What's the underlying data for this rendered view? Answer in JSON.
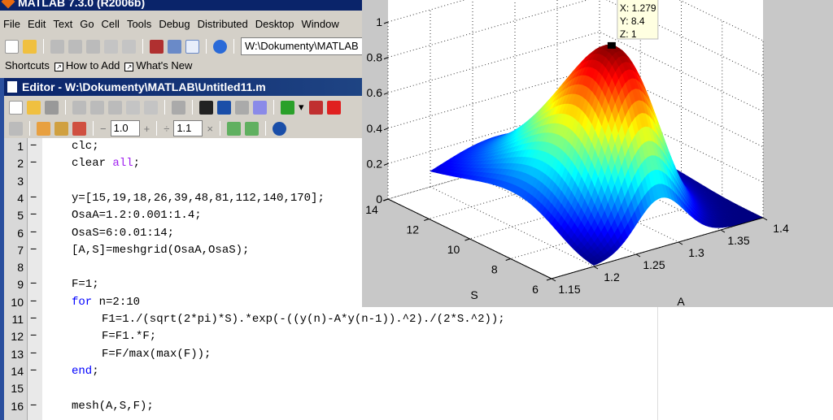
{
  "main_window": {
    "title": "MATLAB  7.3.0 (R2006b)",
    "menu": [
      "File",
      "Edit",
      "Text",
      "Go",
      "Cell",
      "Tools",
      "Debug",
      "Distributed",
      "Desktop",
      "Window"
    ],
    "current_directory": "W:\\Dokumenty\\MATLAB",
    "shortcuts_label": "Shortcuts",
    "shortcuts": [
      "How to Add",
      "What's New"
    ]
  },
  "editor": {
    "title": "Editor - W:\\Dokumenty\\MATLAB\\Untitled11.m",
    "cell_decrement_value": "1.0",
    "cell_divide_value": "1.1",
    "lines": [
      {
        "n": "1",
        "dash": true,
        "indent": 0,
        "parts": [
          {
            "t": "clc;"
          }
        ]
      },
      {
        "n": "2",
        "dash": true,
        "indent": 0,
        "parts": [
          {
            "t": "clear "
          },
          {
            "t": "all",
            "c": "str"
          },
          {
            "t": ";"
          }
        ]
      },
      {
        "n": "3",
        "dash": false,
        "indent": 0,
        "parts": []
      },
      {
        "n": "4",
        "dash": true,
        "indent": 0,
        "parts": [
          {
            "t": "y=[15,19,18,26,39,48,81,112,140,170];"
          }
        ]
      },
      {
        "n": "5",
        "dash": true,
        "indent": 0,
        "parts": [
          {
            "t": "OsaA=1.2:0.001:1.4;"
          }
        ]
      },
      {
        "n": "6",
        "dash": true,
        "indent": 0,
        "parts": [
          {
            "t": "OsaS=6:0.01:14;"
          }
        ]
      },
      {
        "n": "7",
        "dash": true,
        "indent": 0,
        "parts": [
          {
            "t": "[A,S]=meshgrid(OsaA,OsaS);"
          }
        ]
      },
      {
        "n": "8",
        "dash": false,
        "indent": 0,
        "parts": []
      },
      {
        "n": "9",
        "dash": true,
        "indent": 0,
        "parts": [
          {
            "t": "F=1;"
          }
        ]
      },
      {
        "n": "10",
        "dash": true,
        "indent": 0,
        "parts": [
          {
            "t": "for",
            "c": "kw"
          },
          {
            "t": " n=2:10"
          }
        ]
      },
      {
        "n": "11",
        "dash": true,
        "indent": 1,
        "parts": [
          {
            "t": "F1=1./(sqrt(2*pi)*S).*exp(-((y(n)-A*y(n-1)).^2)./(2*S.^2));"
          }
        ]
      },
      {
        "n": "12",
        "dash": true,
        "indent": 1,
        "parts": [
          {
            "t": "F=F1.*F;"
          }
        ]
      },
      {
        "n": "13",
        "dash": true,
        "indent": 1,
        "parts": [
          {
            "t": "F=F/max(max(F));"
          }
        ]
      },
      {
        "n": "14",
        "dash": true,
        "indent": 0,
        "parts": [
          {
            "t": "end",
            "c": "kw"
          },
          {
            "t": ";"
          }
        ]
      },
      {
        "n": "15",
        "dash": false,
        "indent": 0,
        "parts": []
      },
      {
        "n": "16",
        "dash": true,
        "indent": 0,
        "parts": [
          {
            "t": "mesh(A,S,F);"
          }
        ]
      }
    ]
  },
  "chart_data": {
    "type": "surface",
    "title": "",
    "xlabel": "A",
    "ylabel": "S",
    "zlabel": "",
    "y_observations": [
      15,
      19,
      18,
      26,
      39,
      48,
      81,
      112,
      140,
      170
    ],
    "A_range": [
      1.2,
      1.4
    ],
    "S_range": [
      6,
      14
    ],
    "xlim": [
      1.15,
      1.4
    ],
    "ylim": [
      6,
      14
    ],
    "zlim": [
      0,
      1
    ],
    "x_ticks": [
      "1.15",
      "1.2",
      "1.25",
      "1.3",
      "1.35",
      "1.4"
    ],
    "y_ticks": [
      "6",
      "8",
      "10",
      "12",
      "14"
    ],
    "z_ticks": [
      "0",
      "0.2",
      "0.4",
      "0.6",
      "0.8",
      "1"
    ],
    "colormap": "jet",
    "grid": true,
    "datatip": {
      "x": "X: 1.279",
      "y": "Y: 8.4",
      "z": "Z: 1"
    }
  }
}
